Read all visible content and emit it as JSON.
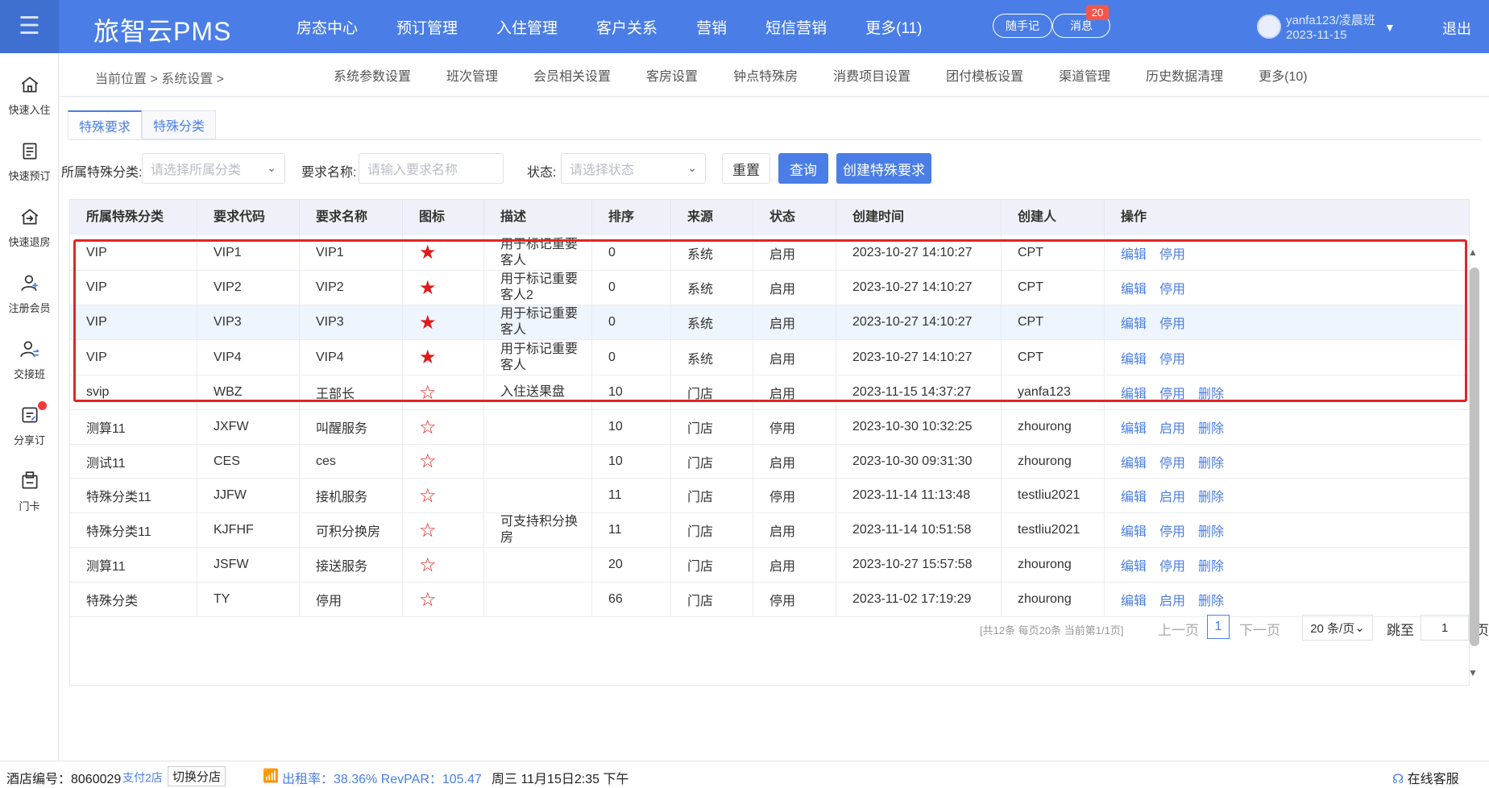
{
  "app": {
    "brand": "旅智云PMS"
  },
  "topnav": [
    "房态中心",
    "预订管理",
    "入住管理",
    "客户关系",
    "营销",
    "短信营销",
    "更多(11)"
  ],
  "header": {
    "note_label": "随手记",
    "msg_label": "消息",
    "msg_count": "20",
    "user": "yanfa123/凌晨班",
    "date": "2023-11-15",
    "logout": "退出"
  },
  "sidebar": [
    {
      "label": "快速入住",
      "icon": "home-icon"
    },
    {
      "label": "快速预订",
      "icon": "booking-icon"
    },
    {
      "label": "快速退房",
      "icon": "checkout-icon"
    },
    {
      "label": "注册会员",
      "icon": "add-member-icon"
    },
    {
      "label": "交接班",
      "icon": "shift-handover-icon"
    },
    {
      "label": "分享订",
      "icon": "share-order-icon"
    },
    {
      "label": "门卡",
      "icon": "door-card-icon"
    }
  ],
  "breadcrumb": "当前位置 > 系统设置 >",
  "subnav": [
    "系统参数设置",
    "班次管理",
    "会员相关设置",
    "客房设置",
    "钟点特殊房",
    "消费项目设置",
    "团付模板设置",
    "渠道管理",
    "历史数据清理",
    "更多(10)"
  ],
  "tabs": [
    "特殊要求",
    "特殊分类"
  ],
  "filters": {
    "category_label": "所属特殊分类:",
    "category_placeholder": "请选择所属分类",
    "name_label": "要求名称:",
    "name_placeholder": "请输入要求名称",
    "status_label": "状态:",
    "status_placeholder": "请选择状态",
    "reset": "重置",
    "search": "查询",
    "create": "创建特殊要求"
  },
  "table": {
    "headers": [
      "所属特殊分类",
      "要求代码",
      "要求名称",
      "图标",
      "描述",
      "排序",
      "来源",
      "状态",
      "创建时间",
      "创建人",
      "操作"
    ],
    "rows": [
      {
        "category": "VIP",
        "code": "VIP1",
        "name": "VIP1",
        "filled": true,
        "desc": "用于标记重要客人",
        "sort": "0",
        "source": "系统",
        "status": "启用",
        "created": "2023-10-27 14:10:27",
        "creator": "CPT",
        "actions": [
          "编辑",
          "停用"
        ]
      },
      {
        "category": "VIP",
        "code": "VIP2",
        "name": "VIP2",
        "filled": true,
        "desc": "用于标记重要客人2",
        "sort": "0",
        "source": "系统",
        "status": "启用",
        "created": "2023-10-27 14:10:27",
        "creator": "CPT",
        "actions": [
          "编辑",
          "停用"
        ]
      },
      {
        "category": "VIP",
        "code": "VIP3",
        "name": "VIP3",
        "filled": true,
        "desc": "用于标记重要客人",
        "sort": "0",
        "source": "系统",
        "status": "启用",
        "created": "2023-10-27 14:10:27",
        "creator": "CPT",
        "actions": [
          "编辑",
          "停用"
        ]
      },
      {
        "category": "VIP",
        "code": "VIP4",
        "name": "VIP4",
        "filled": true,
        "desc": "用于标记重要客人",
        "sort": "0",
        "source": "系统",
        "status": "启用",
        "created": "2023-10-27 14:10:27",
        "creator": "CPT",
        "actions": [
          "编辑",
          "停用"
        ]
      },
      {
        "category": "svip",
        "code": "WBZ",
        "name": "王部长",
        "filled": false,
        "desc": "入住送果盘",
        "sort": "10",
        "source": "门店",
        "status": "启用",
        "created": "2023-11-15 14:37:27",
        "creator": "yanfa123",
        "actions": [
          "编辑",
          "停用",
          "删除"
        ]
      },
      {
        "category": "测算11",
        "code": "JXFW",
        "name": "叫醒服务",
        "filled": false,
        "desc": "",
        "sort": "10",
        "source": "门店",
        "status": "停用",
        "created": "2023-10-30 10:32:25",
        "creator": "zhourong",
        "actions": [
          "编辑",
          "启用",
          "删除"
        ]
      },
      {
        "category": "测试11",
        "code": "CES",
        "name": "ces",
        "filled": false,
        "desc": "",
        "sort": "10",
        "source": "门店",
        "status": "启用",
        "created": "2023-10-30 09:31:30",
        "creator": "zhourong",
        "actions": [
          "编辑",
          "停用",
          "删除"
        ]
      },
      {
        "category": "特殊分类11",
        "code": "JJFW",
        "name": "接机服务",
        "filled": false,
        "desc": "",
        "sort": "11",
        "source": "门店",
        "status": "停用",
        "created": "2023-11-14 11:13:48",
        "creator": "testliu2021",
        "actions": [
          "编辑",
          "启用",
          "删除"
        ]
      },
      {
        "category": "特殊分类11",
        "code": "KJFHF",
        "name": "可积分换房",
        "filled": false,
        "desc": "可支持积分换房",
        "sort": "11",
        "source": "门店",
        "status": "启用",
        "created": "2023-11-14 10:51:58",
        "creator": "testliu2021",
        "actions": [
          "编辑",
          "停用",
          "删除"
        ]
      },
      {
        "category": "测算11",
        "code": "JSFW",
        "name": "接送服务",
        "filled": false,
        "desc": "",
        "sort": "20",
        "source": "门店",
        "status": "启用",
        "created": "2023-10-27 15:57:58",
        "creator": "zhourong",
        "actions": [
          "编辑",
          "停用",
          "删除"
        ]
      },
      {
        "category": "特殊分类",
        "code": "TY",
        "name": "停用",
        "filled": false,
        "desc": "",
        "sort": "66",
        "source": "门店",
        "status": "停用",
        "created": "2023-11-02 17:19:29",
        "creator": "zhourong",
        "actions": [
          "编辑",
          "启用",
          "删除"
        ]
      }
    ]
  },
  "pagination": {
    "info": "[共12条 每页20条 当前第1/1页]",
    "prev": "上一页",
    "current": "1",
    "next": "下一页",
    "size": "20 条/页",
    "jump_label": "跳至",
    "jump_value": "1",
    "page_suffix": "页"
  },
  "statusbar": {
    "hotel_no": "酒店编号：8060029",
    "branches": "支付2店",
    "switch": "切换分店",
    "occupancy": "出租率：38.36% RevPAR：105.47",
    "datetime": "周三 11月15日2:35 下午",
    "support": "在线客服"
  },
  "colors": {
    "primary": "#4a7ee6",
    "highlight_border": "#e42525",
    "star": "#e01b1b"
  }
}
